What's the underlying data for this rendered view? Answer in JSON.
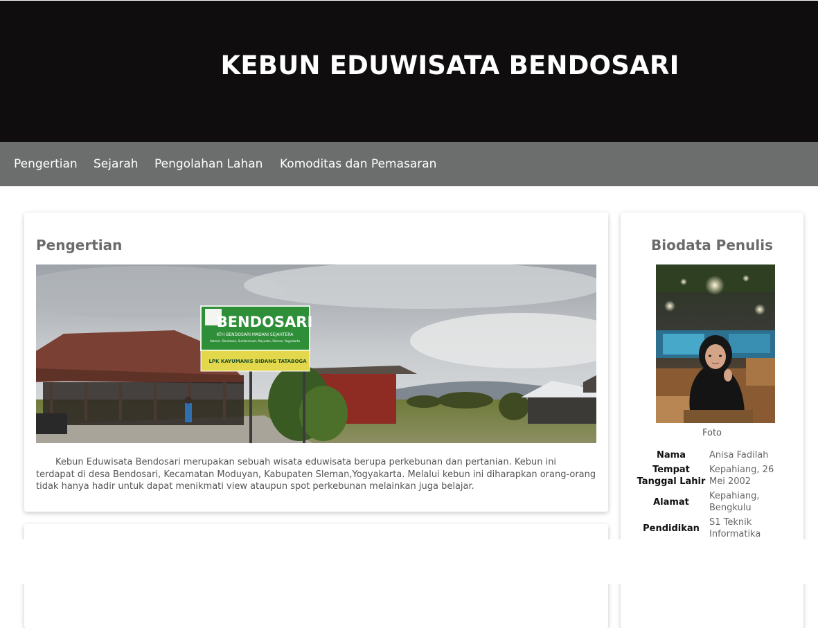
{
  "header": {
    "title": "KEBUN EDUWISATA BENDOSARI"
  },
  "nav": {
    "items": [
      {
        "label": "Pengertian"
      },
      {
        "label": "Sejarah"
      },
      {
        "label": "Pengolahan Lahan"
      },
      {
        "label": "Komoditas dan Pemasaran"
      }
    ]
  },
  "main": {
    "title": "Pengertian",
    "photo": {
      "sign_title": "BENDOSARI",
      "sign_line1": "KTH BENDOSARI MADANI SEJAHTERA",
      "sign_line2": "Alamat : Bendosari, Sumberarum, Moyudan, Sleman, Yogyakarta",
      "sign_banner": "LPK KAYUMANIS BIDANG TATABOGA"
    },
    "paragraph": "Kebun Eduwisata Bendosari merupakan sebuah wisata eduwisata berupa perkebunan dan pertanian. Kebun ini terdapat di desa Bendosari, Kecamatan Moduyan, Kabupaten Sleman,Yogyakarta. Melalui kebun ini diharapkan orang-orang tidak hanya hadir untuk dapat menikmati view ataupun spot perkebunan melainkan juga belajar."
  },
  "bio": {
    "title": "Biodata Penulis",
    "caption": "Foto",
    "rows": [
      {
        "label": "Nama",
        "value": "Anisa Fadilah"
      },
      {
        "label": "Tempat Tanggal Lahir",
        "value": "Kepahiang, 26 Mei 2002"
      },
      {
        "label": "Alamat",
        "value": "Kepahiang, Bengkulu"
      },
      {
        "label": "Pendidikan",
        "value": "S1 Teknik Informatika"
      }
    ]
  },
  "colors": {
    "header_bg": "#0f0d0d",
    "nav_bg": "#6b6e6c",
    "title_gray": "#6b6b6b"
  }
}
